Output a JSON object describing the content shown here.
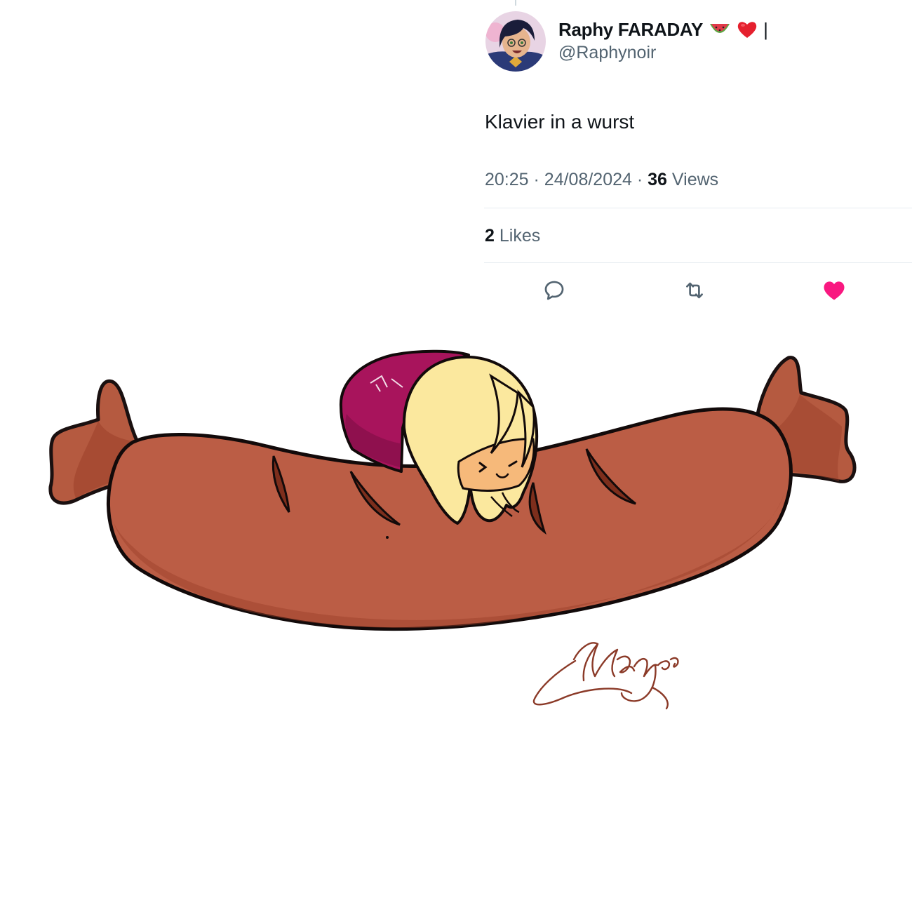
{
  "tweet": {
    "author": {
      "display_name": "Raphy FARADAY",
      "name_emojis": [
        "watermelon-emoji",
        "red-heart-emoji"
      ],
      "name_suffix": "|",
      "handle": "@Raphynoir"
    },
    "text": "Klavier in a wurst",
    "time": "20:25",
    "separator": "·",
    "date": "24/08/2024",
    "views_count": "36",
    "views_label": "Views",
    "likes_count": "2",
    "likes_label": "Likes",
    "liked": true
  },
  "actions": [
    {
      "icon": "reply-icon",
      "color": "#536471"
    },
    {
      "icon": "retweet-icon",
      "color": "#536471"
    },
    {
      "icon": "heart-icon",
      "color": "#f91880"
    }
  ],
  "artwork": {
    "subject": "chibi character with blonde hair and magenta hood lying on a giant sausage",
    "signature": "Manyes",
    "colors": {
      "sausage": "#bb5d45",
      "sausage_shadow": "#9c3f28",
      "hair": "#fbe89e",
      "hood": "#a8145c",
      "skin": "#f6b97a",
      "signature_ink": "#8b3a28"
    }
  }
}
